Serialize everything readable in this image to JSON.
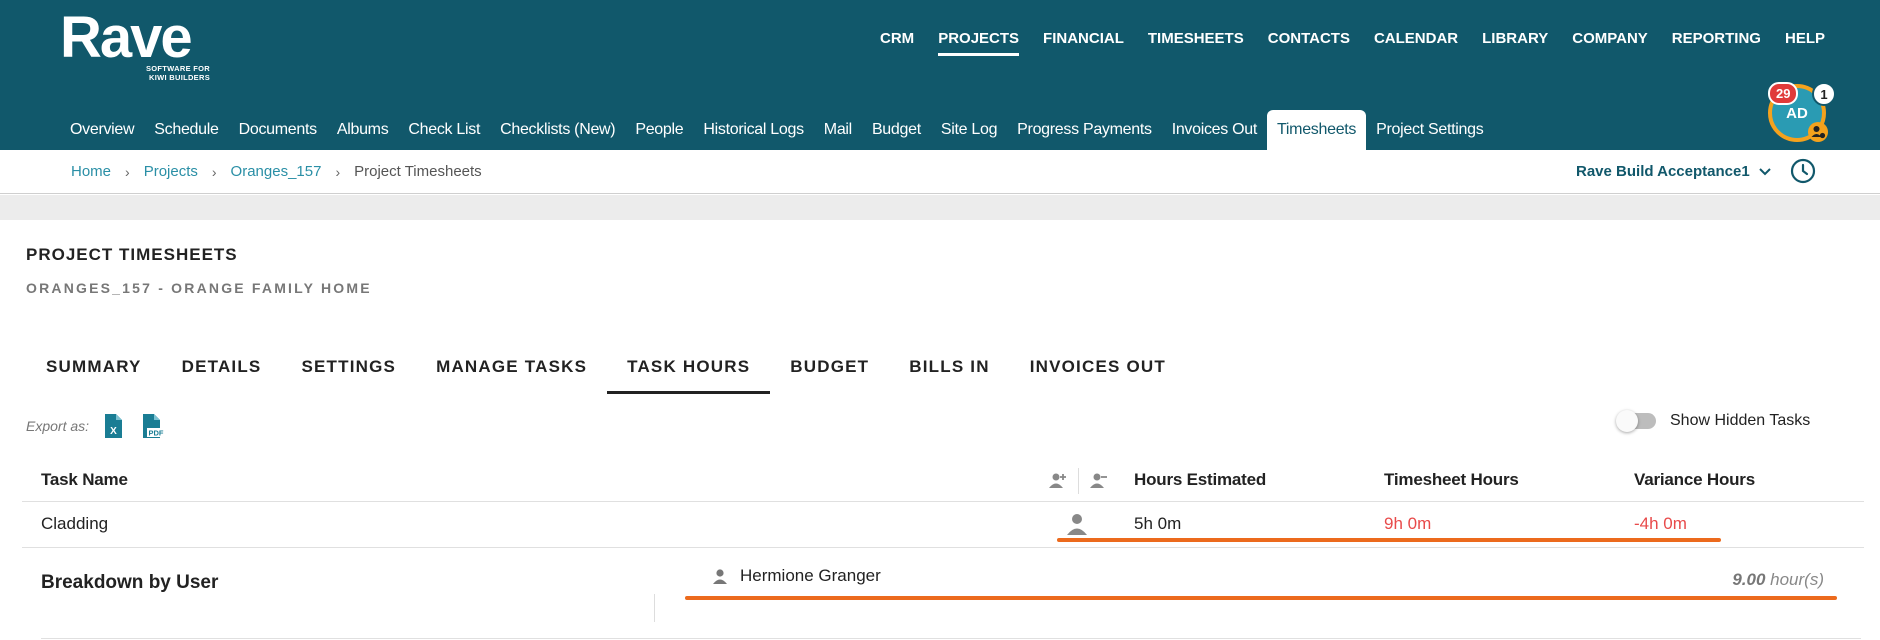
{
  "logo": {
    "word": "Rave",
    "tagline_1": "SOFTWARE FOR",
    "tagline_2": "KIWI BUILDERS"
  },
  "main_nav": [
    "CRM",
    "PROJECTS",
    "FINANCIAL",
    "TIMESHEETS",
    "CONTACTS",
    "CALENDAR",
    "LIBRARY",
    "COMPANY",
    "REPORTING",
    "HELP"
  ],
  "main_nav_active": "PROJECTS",
  "sub_nav": [
    "Overview",
    "Schedule",
    "Documents",
    "Albums",
    "Check List",
    "Checklists (New)",
    "People",
    "Historical Logs",
    "Mail",
    "Budget",
    "Site Log",
    "Progress Payments",
    "Invoices Out",
    "Timesheets",
    "Project Settings"
  ],
  "sub_nav_active": "Timesheets",
  "user": {
    "initials": "AD",
    "notifications": "29",
    "messages": "1"
  },
  "breadcrumb": {
    "home": "Home",
    "projects": "Projects",
    "project": "Oranges_157",
    "current": "Project Timesheets",
    "separator": "›"
  },
  "company_select": {
    "value": "Rave Build Acceptance1"
  },
  "page": {
    "title": "PROJECT TIMESHEETS",
    "subtitle": "ORANGES_157 - ORANGE FAMILY HOME"
  },
  "tabs": [
    "SUMMARY",
    "DETAILS",
    "SETTINGS",
    "MANAGE TASKS",
    "TASK HOURS",
    "BUDGET",
    "BILLS IN",
    "INVOICES OUT"
  ],
  "tabs_active": "TASK HOURS",
  "export": {
    "label": "Export as:",
    "excel_icon": "excel-export-icon",
    "pdf_icon": "pdf-export-icon",
    "excel_text": "X",
    "pdf_text": "PDF"
  },
  "hidden_tasks_toggle": {
    "label": "Show Hidden Tasks",
    "on": false
  },
  "table": {
    "headers": {
      "task_name": "Task Name",
      "hours_estimated": "Hours Estimated",
      "timesheet_hours": "Timesheet Hours",
      "variance_hours": "Variance Hours"
    },
    "rows": [
      {
        "task_name": "Cladding",
        "hours_estimated": "5h 0m",
        "timesheet_hours": "9h 0m",
        "variance_hours": "-4h 0m"
      }
    ]
  },
  "breakdown": {
    "title": "Breakdown by User",
    "users": [
      {
        "name": "Hermione Granger",
        "hours_value": "9.00",
        "hours_unit": "hour(s)"
      }
    ]
  },
  "colors": {
    "header": "#11586b",
    "link": "#2a8fa6",
    "negative": "#e84a4a",
    "annotation": "#ec6a1d",
    "badge": "#e03a3a"
  }
}
